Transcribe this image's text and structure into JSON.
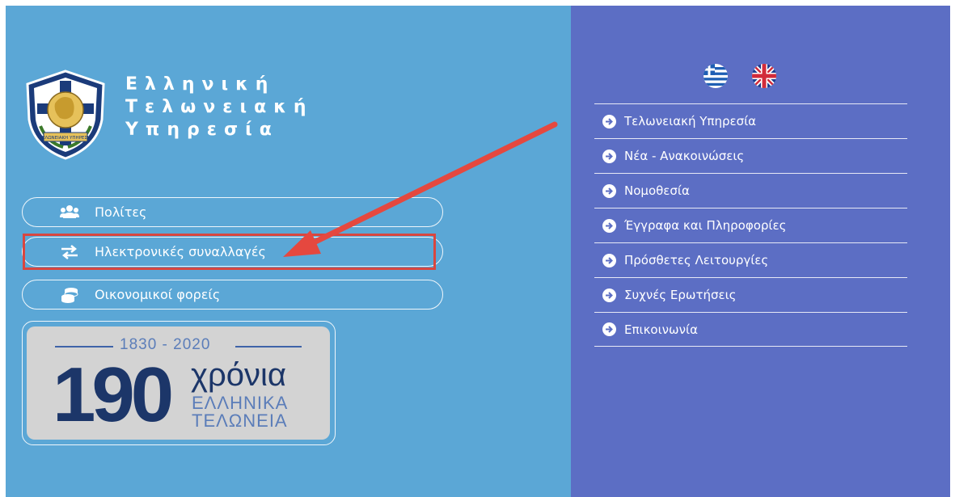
{
  "brand": {
    "line1": "Ελληνική",
    "line2": "Τελωνειακή",
    "line3": "Υπηρεσία",
    "crest_text": "ΤΕΛΩΝΕΙΑΚΗ ΥΠΗΡΕΣΙΑ"
  },
  "left_menu": {
    "items": [
      {
        "label": "Πολίτες",
        "icon": "users-icon"
      },
      {
        "label": "Ηλεκτρονικές συναλλαγές",
        "icon": "exchange-arrows-icon"
      },
      {
        "label": "Οικονομικοί φορείς",
        "icon": "coins-icon"
      }
    ]
  },
  "badge": {
    "years": "1830 - 2020",
    "number": "190",
    "word": "χρόνια",
    "line1": "ΕΛΛΗΝΙΚΑ",
    "line2": "ΤΕΛΩΝΕΙΑ"
  },
  "languages": [
    "greek-flag-icon",
    "uk-flag-icon"
  ],
  "right_nav": {
    "items": [
      "Τελωνειακή Υπηρεσία",
      "Νέα - Ανακοινώσεις",
      "Νομοθεσία",
      "Έγγραφα και Πληροφορίες",
      "Πρόσθετες Λειτουργίες",
      "Συχνές Ερωτήσεις",
      "Επικοινωνία"
    ]
  },
  "colors": {
    "left_bg": "#5ba7d6",
    "right_bg": "#5c6ec4",
    "highlight": "#d9463f",
    "badge_navy": "#1c3669"
  }
}
